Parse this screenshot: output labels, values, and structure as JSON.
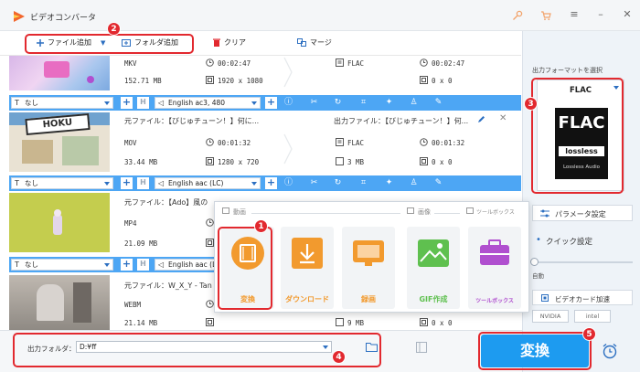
{
  "app": {
    "title": "ビデオコンバータ"
  },
  "toolbar": {
    "add_file": "ファイル追加",
    "add_folder": "フォルダ追加",
    "clear": "クリア",
    "merge": "マージ"
  },
  "files": [
    {
      "source_label": "",
      "format": "MKV",
      "duration": "00:02:47",
      "size": "152.71 MB",
      "resolution": "1920 x 1080",
      "out_label": "",
      "out_format": "FLAC",
      "out_duration": "00:02:47",
      "out_size": "",
      "out_resolution": "0 x 0",
      "subtitle": "なし",
      "audio": "English ac3, 480"
    },
    {
      "source_label": "元ファイル：【びじゅチューン！】何に...",
      "format": "MOV",
      "duration": "00:01:32",
      "size": "33.44 MB",
      "resolution": "1280 x 720",
      "out_label": "出力ファイル：【びじゅチューン！】何...",
      "out_format": "FLAC",
      "out_duration": "00:01:32",
      "out_size": "3 MB",
      "out_resolution": "0 x 0",
      "subtitle": "なし",
      "audio": "English aac (LC)"
    },
    {
      "source_label": "元ファイル：【Ado】風の",
      "format": "MP4",
      "duration": "",
      "size": "21.09 MB",
      "resolution": "",
      "subtitle": "なし",
      "audio": "English aac (LC)"
    },
    {
      "source_label": "元ファイル：W_X_Y - Tan",
      "format": "WEBM",
      "duration": "",
      "size": "21.14 MB",
      "resolution": "",
      "out_size": "9 MB",
      "out_resolution": "0 x 0"
    }
  ],
  "popup": {
    "sections": {
      "video": "動画",
      "image": "画像",
      "toolbox": "ツールボックス"
    },
    "tiles": [
      "変換",
      "ダウンロード",
      "録画",
      "GIF作成",
      "ツールボックス"
    ]
  },
  "right_panel": {
    "output_format_label": "出力フォーマットを選択",
    "format_name": "FLAC",
    "logo_text": "FLAC",
    "logo_sub": "lossless",
    "logo_caption": "Lossless Audio",
    "param_settings": "パラメータ設定",
    "quick_settings": "クイック設定",
    "auto_label": "自動",
    "gpu_accel": "ビデオカード加速",
    "brand_nvidia": "NVIDIA",
    "brand_intel": "intel"
  },
  "bottom": {
    "output_folder_label": "出力フォルダ：",
    "output_folder_value": "D:¥ff",
    "convert_label": "変換"
  },
  "badges": [
    "1",
    "2",
    "3",
    "4",
    "5"
  ],
  "colors": {
    "accent": "#4da6f4",
    "convert": "#1d9bf0",
    "highlight": "#e2292f",
    "tile_icon": "#f29a2e",
    "toolbox_icon": "#b04fcf"
  }
}
